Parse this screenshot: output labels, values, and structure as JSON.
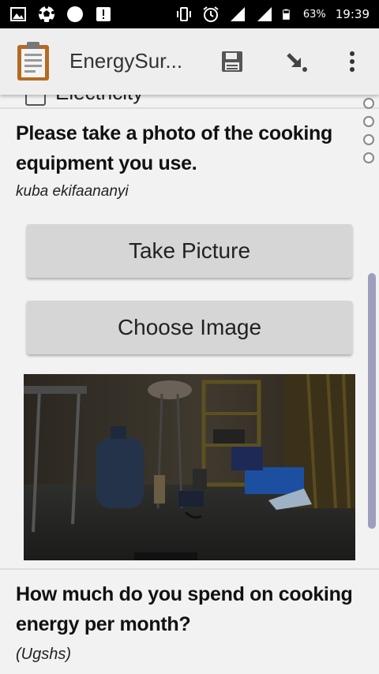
{
  "status_bar": {
    "battery_percent": "63%",
    "time": "19:39"
  },
  "toolbar": {
    "title": "EnergySur...",
    "save_icon": "save-icon",
    "goto_icon": "goto-arrow-icon",
    "menu_icon": "overflow-menu-icon"
  },
  "previous_option": {
    "label": "Electricity"
  },
  "question_photo": {
    "text": "Please take a photo of the cooking equipment you use.",
    "hint": "kuba ekifaananyi",
    "take_picture_label": "Take Picture",
    "choose_image_label": "Choose Image"
  },
  "question_spend": {
    "text": "How much do you spend on cooking energy per month?",
    "hint": "(Ugshs)"
  },
  "colors": {
    "toolbar_bg": "#eeeeee",
    "button_bg": "#d6d6d6",
    "scrollbar": "#9e9fbd"
  }
}
